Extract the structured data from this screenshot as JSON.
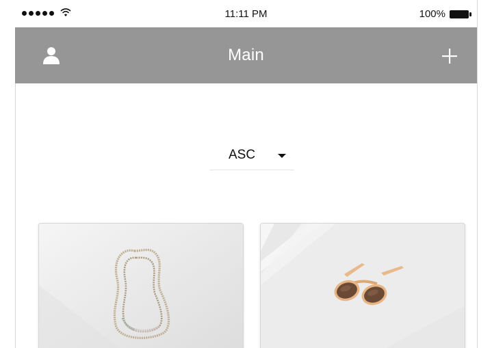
{
  "status_bar": {
    "time": "11:11 PM",
    "battery": "100%",
    "icons": [
      "signal-dots-icon",
      "wifi-icon",
      "battery-icon"
    ]
  },
  "nav": {
    "title": "Main",
    "left_icon": "user-icon",
    "right_icon": "plus-icon"
  },
  "sort": {
    "selected": "ASC",
    "icon": "caret-down-icon"
  },
  "products": [
    {
      "image": "necklace"
    },
    {
      "image": "sunglasses"
    }
  ],
  "colors": {
    "nav_background": "#969696",
    "nav_text": "#ffffff",
    "page_background": "#ffffff"
  }
}
